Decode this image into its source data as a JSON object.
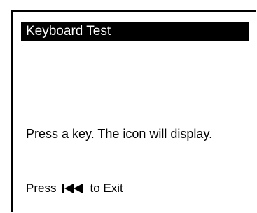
{
  "screen": {
    "title": "Keyboard Test",
    "message": "Press a key. The icon will display.",
    "exit_prefix": "Press",
    "exit_icon": "skip-back-icon",
    "exit_suffix": "to Exit"
  }
}
